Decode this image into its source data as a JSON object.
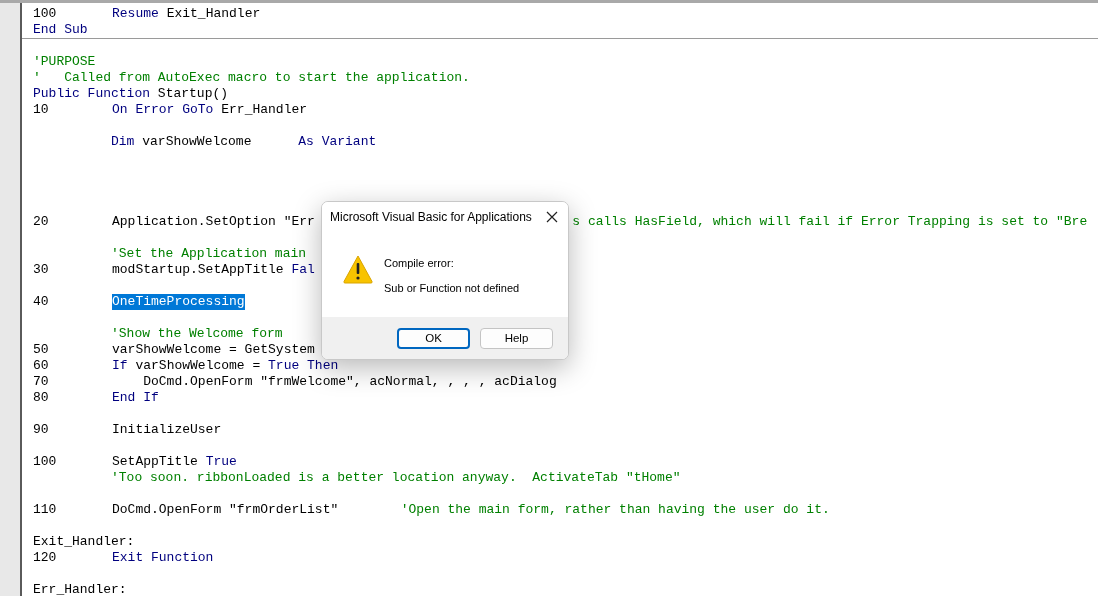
{
  "code_window": {
    "lines": [
      {
        "kind": "code",
        "number": "100",
        "segments": [
          {
            "kind": "keyword",
            "text": "Resume"
          },
          {
            "kind": "plain",
            "text": " Exit_Handler"
          }
        ]
      },
      {
        "kind": "code",
        "segments": [
          {
            "kind": "keyword",
            "text": "End Sub"
          }
        ]
      },
      {
        "kind": "separator"
      },
      {
        "kind": "blank"
      },
      {
        "kind": "code",
        "segments": [
          {
            "kind": "comment",
            "text": "'PURPOSE"
          }
        ]
      },
      {
        "kind": "code",
        "segments": [
          {
            "kind": "comment",
            "text": "'   Called from AutoExec macro to start the application."
          }
        ]
      },
      {
        "kind": "code",
        "segments": [
          {
            "kind": "keyword",
            "text": "Public Function"
          },
          {
            "kind": "plain",
            "text": " Startup()"
          }
        ]
      },
      {
        "kind": "code",
        "number": "10",
        "segments": [
          {
            "kind": "keyword",
            "text": "On Error GoTo"
          },
          {
            "kind": "plain",
            "text": " Err_Handler"
          }
        ]
      },
      {
        "kind": "blank"
      },
      {
        "kind": "code",
        "segments": [
          {
            "kind": "keyword",
            "text": "          Dim"
          },
          {
            "kind": "plain",
            "text": " varShowWelcome      "
          },
          {
            "kind": "keyword",
            "text": "As Variant"
          }
        ]
      },
      {
        "kind": "blank"
      },
      {
        "kind": "blank"
      },
      {
        "kind": "blank"
      },
      {
        "kind": "blank"
      },
      {
        "kind": "code",
        "number": "20",
        "segments": [
          {
            "kind": "plain",
            "text": "Application.SetOption \"Err"
          },
          {
            "kind": "comment",
            "text": "                                 s calls HasField, which will fail if Error Trapping is set to \"Bre"
          }
        ]
      },
      {
        "kind": "blank"
      },
      {
        "kind": "code",
        "segments": [
          {
            "kind": "comment",
            "text": "          'Set the Application main"
          }
        ]
      },
      {
        "kind": "code",
        "number": "30",
        "segments": [
          {
            "kind": "plain",
            "text": "modStartup.SetAppTitle "
          },
          {
            "kind": "keyword",
            "text": "Fal"
          }
        ]
      },
      {
        "kind": "blank"
      },
      {
        "kind": "code",
        "number": "40",
        "segments": [
          {
            "kind": "selected",
            "text": "OneTimeProcessing"
          }
        ]
      },
      {
        "kind": "blank"
      },
      {
        "kind": "code",
        "segments": [
          {
            "kind": "comment",
            "text": "          'Show the Welcome form"
          }
        ]
      },
      {
        "kind": "code",
        "number": "50",
        "segments": [
          {
            "kind": "plain",
            "text": "varShowWelcome = GetSystem"
          }
        ]
      },
      {
        "kind": "code",
        "number": "60",
        "segments": [
          {
            "kind": "keyword",
            "text": "If"
          },
          {
            "kind": "plain",
            "text": " varShowWelcome = "
          },
          {
            "kind": "keyword",
            "text": "True Then"
          }
        ]
      },
      {
        "kind": "code",
        "number": "70",
        "segments": [
          {
            "kind": "plain",
            "text": "    DoCmd.OpenForm \"frmWelcome\", acNormal, , , , acDialog"
          }
        ]
      },
      {
        "kind": "code",
        "number": "80",
        "segments": [
          {
            "kind": "keyword",
            "text": "End If"
          }
        ]
      },
      {
        "kind": "blank"
      },
      {
        "kind": "code",
        "number": "90",
        "segments": [
          {
            "kind": "plain",
            "text": "InitializeUser"
          }
        ]
      },
      {
        "kind": "blank"
      },
      {
        "kind": "code",
        "number": "100",
        "segments": [
          {
            "kind": "plain",
            "text": "SetAppTitle "
          },
          {
            "kind": "keyword",
            "text": "True"
          }
        ]
      },
      {
        "kind": "code",
        "segments": [
          {
            "kind": "comment",
            "text": "          'Too soon. ribbonLoaded is a better location anyway.  ActivateTab \"tHome\""
          }
        ]
      },
      {
        "kind": "blank"
      },
      {
        "kind": "code",
        "number": "110",
        "segments": [
          {
            "kind": "plain",
            "text": "DoCmd.OpenForm \"frmOrderList\""
          },
          {
            "kind": "comment",
            "text": "        'Open the main form, rather than having the user do it."
          }
        ]
      },
      {
        "kind": "blank"
      },
      {
        "kind": "code",
        "segments": [
          {
            "kind": "plain",
            "text": "Exit_Handler:"
          }
        ]
      },
      {
        "kind": "code",
        "number": "120",
        "segments": [
          {
            "kind": "keyword",
            "text": "Exit Function"
          }
        ]
      },
      {
        "kind": "blank"
      },
      {
        "kind": "code",
        "segments": [
          {
            "kind": "plain",
            "text": "Err_Handler:"
          }
        ]
      }
    ]
  },
  "dialog": {
    "title": "Microsoft Visual Basic for Applications",
    "heading": "Compile error:",
    "message": "Sub or Function not defined",
    "buttons": [
      {
        "label": "OK",
        "focused": true
      },
      {
        "label": "Help",
        "focused": false
      }
    ]
  }
}
